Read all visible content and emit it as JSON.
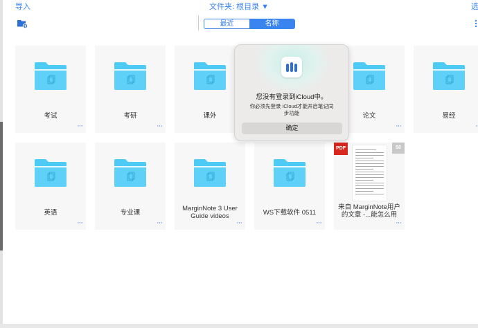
{
  "toolbar": {
    "import_label": "导入",
    "folder_title": "文件夹: 根目录 ▼",
    "select_label": "选"
  },
  "sort_tabs": [
    "最近",
    "名称"
  ],
  "selected_tab": "名称",
  "folders": [
    {
      "name": "考试"
    },
    {
      "name": "考研"
    },
    {
      "name": "课外"
    },
    {
      "name": ""
    },
    {
      "name": "论文"
    },
    {
      "name": "易经"
    },
    {
      "name": "英语"
    },
    {
      "name": "专业课"
    },
    {
      "name": "MarginNote 3 User Guide videos"
    },
    {
      "name": "WS下载软件 0511"
    }
  ],
  "document": {
    "name": "来自 MarginNote用户的文章 -...能怎么用",
    "type_badge": "PDF",
    "page_count": "58"
  },
  "more_glyph": "···",
  "dialog": {
    "title": "您没有登录到iCloud中。",
    "message": "你必须先登录 iCloud才能开启笔记同步功能",
    "ok_label": "确定"
  },
  "colors": {
    "accent": "#3a84f0",
    "folder": "#4ecbf5",
    "pdf_badge": "#d9281f"
  },
  "icons": [
    "new-folder-icon",
    "more-vertical-icon",
    "folder-icon",
    "marginnote-app-icon"
  ]
}
